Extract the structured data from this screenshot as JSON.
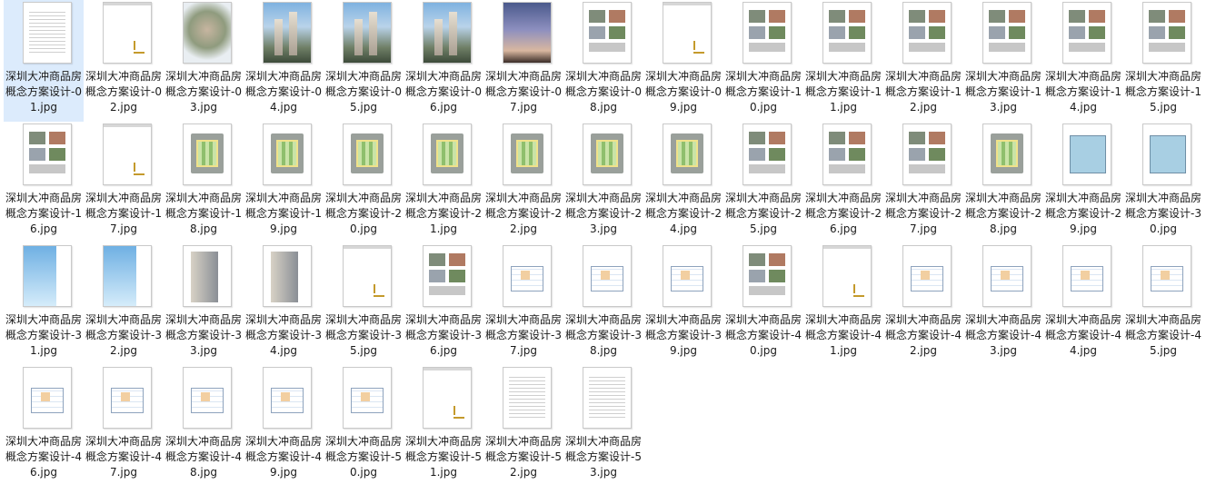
{
  "files": [
    {
      "name": "深圳大冲商品房概念方案设计-01.jpg",
      "thumb": "text",
      "selected": true
    },
    {
      "name": "深圳大冲商品房概念方案设计-02.jpg",
      "thumb": "logo"
    },
    {
      "name": "深圳大冲商品房概念方案设计-03.jpg",
      "thumb": "aerial"
    },
    {
      "name": "深圳大冲商品房概念方案设计-04.jpg",
      "thumb": "tower"
    },
    {
      "name": "深圳大冲商品房概念方案设计-05.jpg",
      "thumb": "tower"
    },
    {
      "name": "深圳大冲商品房概念方案设计-06.jpg",
      "thumb": "tower"
    },
    {
      "name": "深圳大冲商品房概念方案设计-07.jpg",
      "thumb": "dusk"
    },
    {
      "name": "深圳大冲商品房概念方案设计-08.jpg",
      "thumb": "collage"
    },
    {
      "name": "深圳大冲商品房概念方案设计-09.jpg",
      "thumb": "logo"
    },
    {
      "name": "深圳大冲商品房概念方案设计-10.jpg",
      "thumb": "collage"
    },
    {
      "name": "深圳大冲商品房概念方案设计-11.jpg",
      "thumb": "collage"
    },
    {
      "name": "深圳大冲商品房概念方案设计-12.jpg",
      "thumb": "collage"
    },
    {
      "name": "深圳大冲商品房概念方案设计-13.jpg",
      "thumb": "collage"
    },
    {
      "name": "深圳大冲商品房概念方案设计-14.jpg",
      "thumb": "collage"
    },
    {
      "name": "深圳大冲商品房概念方案设计-15.jpg",
      "thumb": "collage"
    },
    {
      "name": "深圳大冲商品房概念方案设计-16.jpg",
      "thumb": "collage"
    },
    {
      "name": "深圳大冲商品房概念方案设计-17.jpg",
      "thumb": "logo"
    },
    {
      "name": "深圳大冲商品房概念方案设计-18.jpg",
      "thumb": "plan"
    },
    {
      "name": "深圳大冲商品房概念方案设计-19.jpg",
      "thumb": "plan"
    },
    {
      "name": "深圳大冲商品房概念方案设计-20.jpg",
      "thumb": "plan"
    },
    {
      "name": "深圳大冲商品房概念方案设计-21.jpg",
      "thumb": "plan"
    },
    {
      "name": "深圳大冲商品房概念方案设计-22.jpg",
      "thumb": "plan"
    },
    {
      "name": "深圳大冲商品房概念方案设计-23.jpg",
      "thumb": "plan"
    },
    {
      "name": "深圳大冲商品房概念方案设计-24.jpg",
      "thumb": "plan"
    },
    {
      "name": "深圳大冲商品房概念方案设计-25.jpg",
      "thumb": "collage"
    },
    {
      "name": "深圳大冲商品房概念方案设计-26.jpg",
      "thumb": "collage"
    },
    {
      "name": "深圳大冲商品房概念方案设计-27.jpg",
      "thumb": "collage"
    },
    {
      "name": "深圳大冲商品房概念方案设计-28.jpg",
      "thumb": "plan"
    },
    {
      "name": "深圳大冲商品房概念方案设计-29.jpg",
      "thumb": "blue"
    },
    {
      "name": "深圳大冲商品房概念方案设计-30.jpg",
      "thumb": "blue"
    },
    {
      "name": "深圳大冲商品房概念方案设计-31.jpg",
      "thumb": "sky"
    },
    {
      "name": "深圳大冲商品房概念方案设计-32.jpg",
      "thumb": "sky"
    },
    {
      "name": "深圳大冲商品房概念方案设计-33.jpg",
      "thumb": "elev"
    },
    {
      "name": "深圳大冲商品房概念方案设计-34.jpg",
      "thumb": "elev"
    },
    {
      "name": "深圳大冲商品房概念方案设计-35.jpg",
      "thumb": "logo"
    },
    {
      "name": "深圳大冲商品房概念方案设计-36.jpg",
      "thumb": "collage"
    },
    {
      "name": "深圳大冲商品房概念方案设计-37.jpg",
      "thumb": "floor"
    },
    {
      "name": "深圳大冲商品房概念方案设计-38.jpg",
      "thumb": "floor"
    },
    {
      "name": "深圳大冲商品房概念方案设计-39.jpg",
      "thumb": "floor"
    },
    {
      "name": "深圳大冲商品房概念方案设计-40.jpg",
      "thumb": "collage"
    },
    {
      "name": "深圳大冲商品房概念方案设计-41.jpg",
      "thumb": "logo"
    },
    {
      "name": "深圳大冲商品房概念方案设计-42.jpg",
      "thumb": "floor"
    },
    {
      "name": "深圳大冲商品房概念方案设计-43.jpg",
      "thumb": "floor"
    },
    {
      "name": "深圳大冲商品房概念方案设计-44.jpg",
      "thumb": "floor"
    },
    {
      "name": "深圳大冲商品房概念方案设计-45.jpg",
      "thumb": "floor"
    },
    {
      "name": "深圳大冲商品房概念方案设计-46.jpg",
      "thumb": "floor"
    },
    {
      "name": "深圳大冲商品房概念方案设计-47.jpg",
      "thumb": "floor"
    },
    {
      "name": "深圳大冲商品房概念方案设计-48.jpg",
      "thumb": "floor"
    },
    {
      "name": "深圳大冲商品房概念方案设计-49.jpg",
      "thumb": "floor"
    },
    {
      "name": "深圳大冲商品房概念方案设计-50.jpg",
      "thumb": "floor"
    },
    {
      "name": "深圳大冲商品房概念方案设计-51.jpg",
      "thumb": "logo"
    },
    {
      "name": "深圳大冲商品房概念方案设计-52.jpg",
      "thumb": "text"
    },
    {
      "name": "深圳大冲商品房概念方案设计-53.jpg",
      "thumb": "text"
    }
  ]
}
